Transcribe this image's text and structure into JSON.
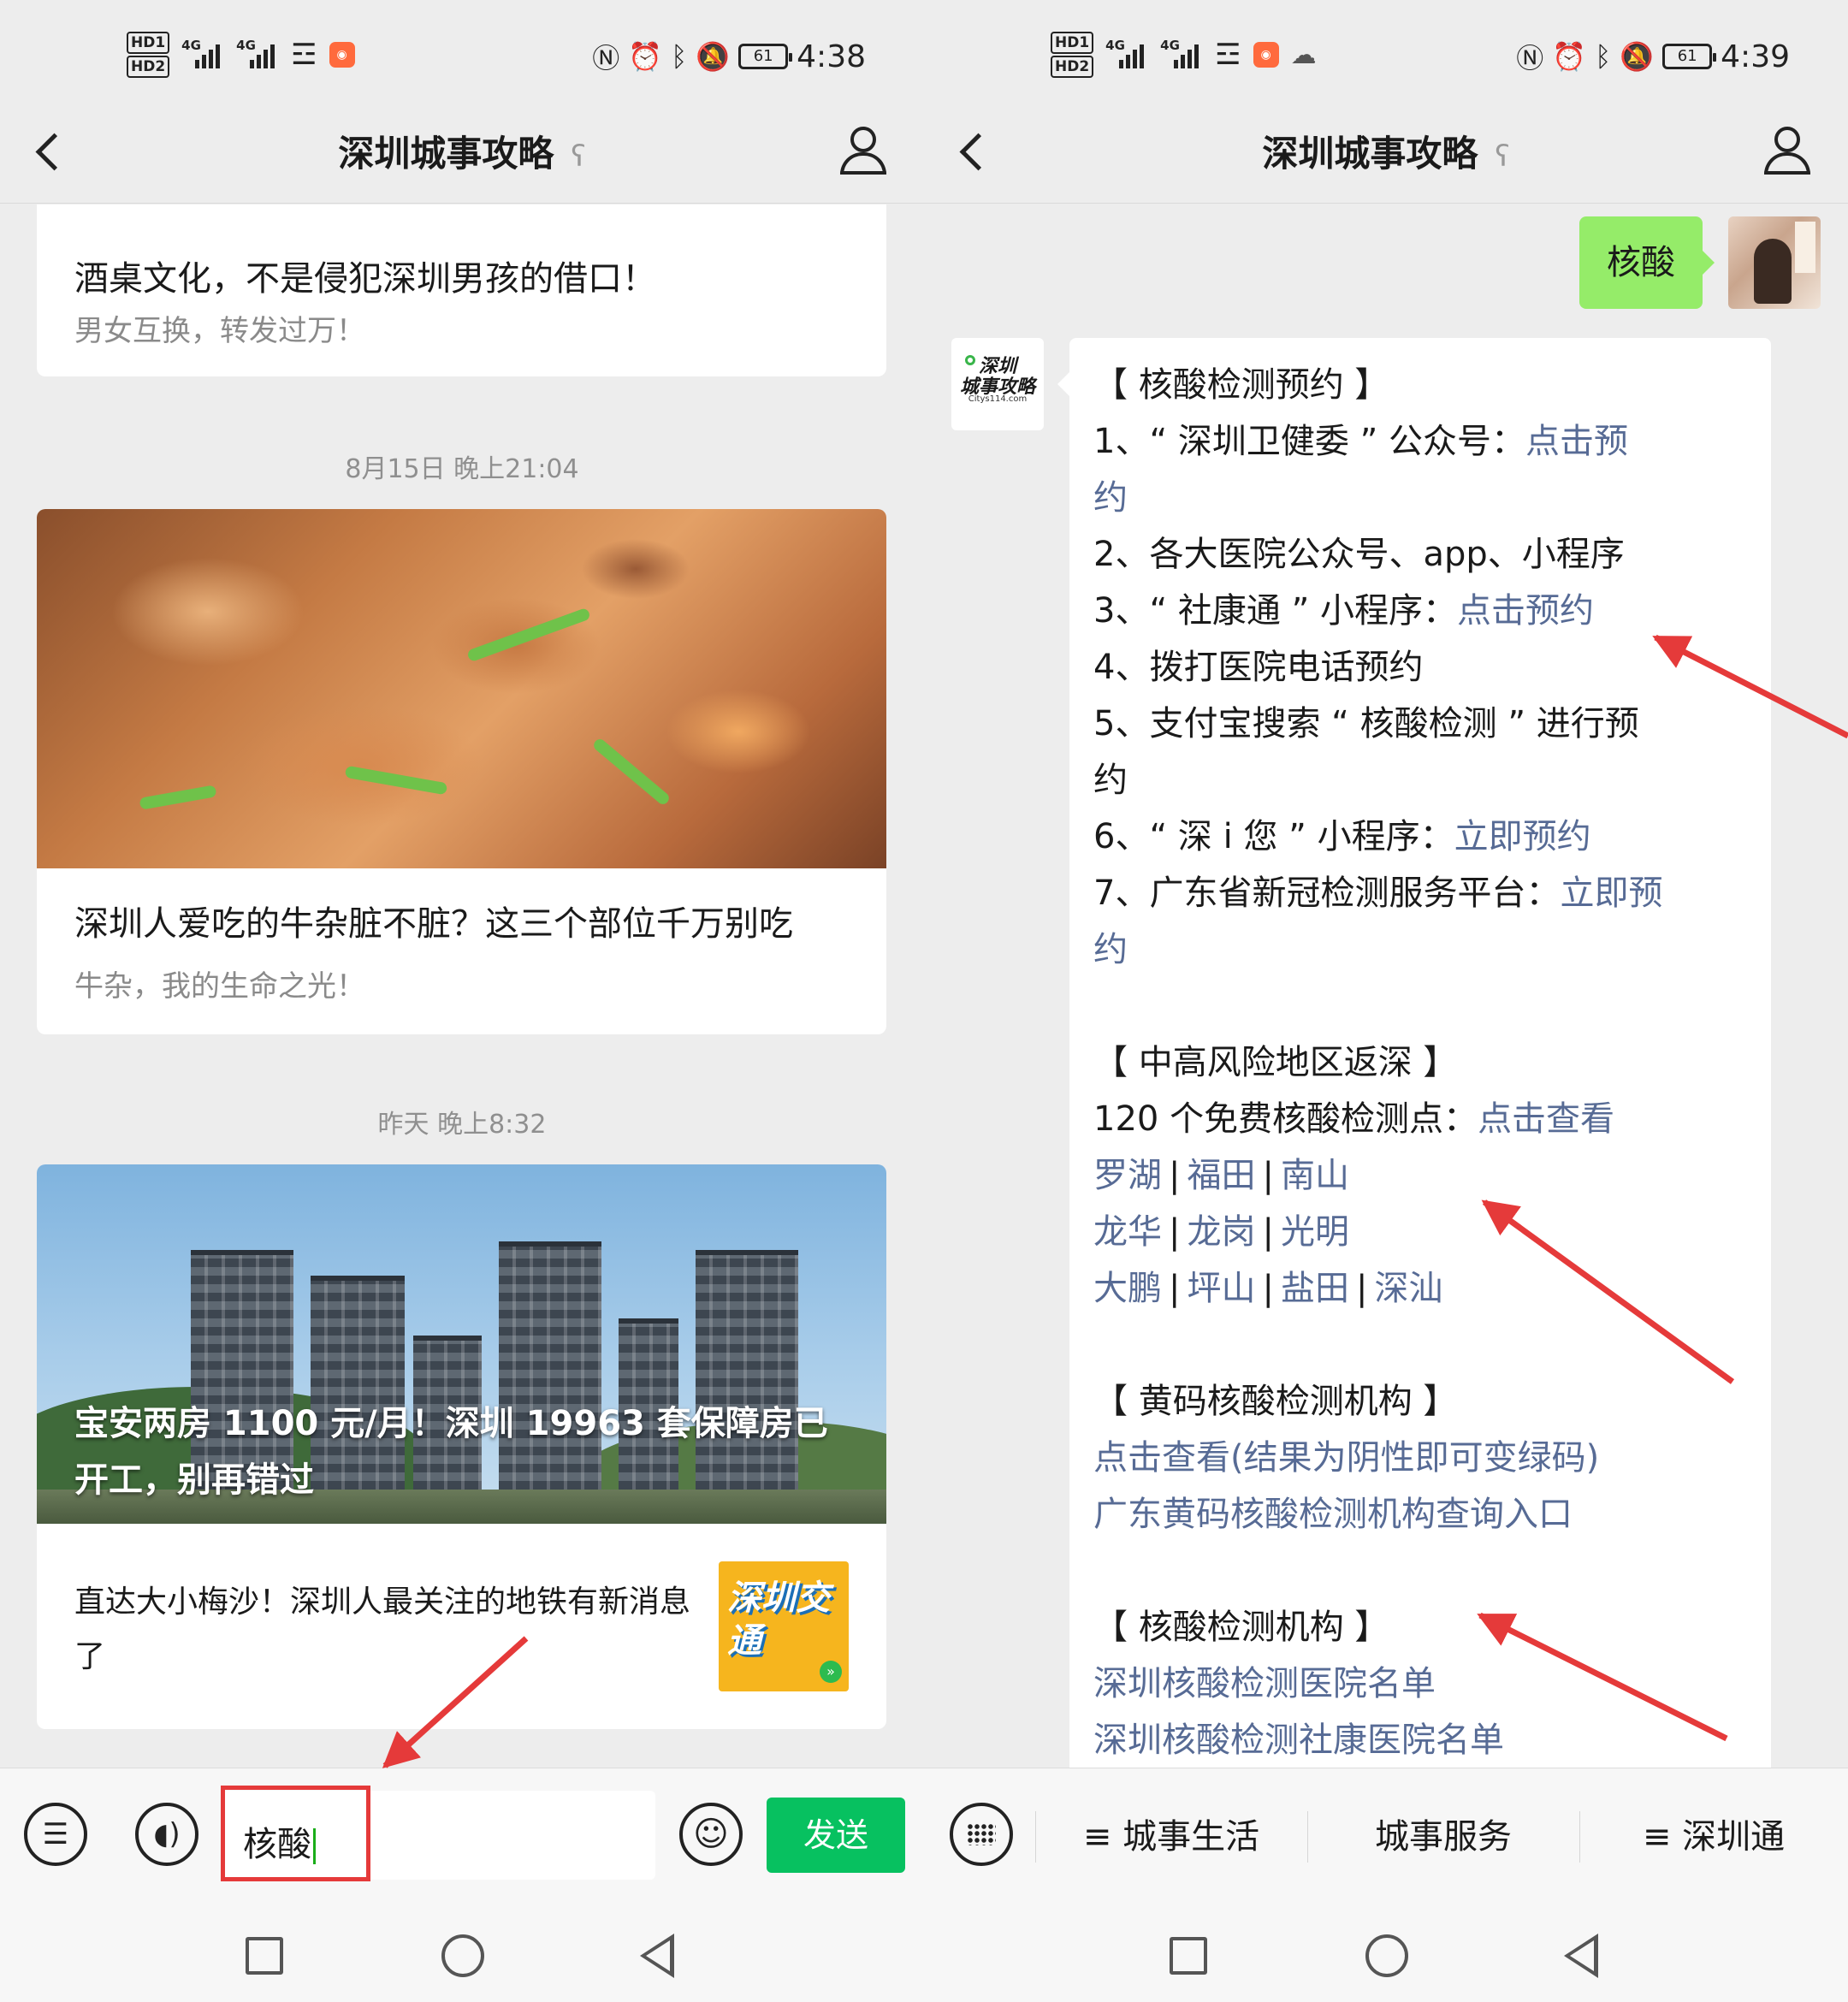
{
  "left": {
    "status": {
      "network_badges": [
        "HD1",
        "HD2"
      ],
      "signal1": "4G",
      "signal2": "4G",
      "battery": "61",
      "time": "4:38"
    },
    "header": {
      "title": "深圳城事攻略"
    },
    "articles": [
      {
        "title": "酒桌文化，不是侵犯深圳男孩的借口！",
        "subtitle": "男女互换，转发过万！"
      },
      {
        "timestamp": "8月15日 晚上21:04",
        "title": "深圳人爱吃的牛杂脏不脏？这三个部位千万别吃",
        "subtitle": "牛杂，我的生命之光！"
      },
      {
        "timestamp": "昨天 晚上8:32",
        "cover_title": "宝安两房 1100 元/月！深圳 19963 套保障房已开工，别再错过",
        "item_title": "直达大小梅沙！深圳人最关注的地铁有新消息了",
        "thumb_text": "深圳交通"
      }
    ],
    "input": {
      "value": "核酸",
      "send_label": "发送"
    }
  },
  "right": {
    "status": {
      "network_badges": [
        "HD1",
        "HD2"
      ],
      "signal1": "4G",
      "signal2": "4G",
      "battery": "61",
      "time": "4:39"
    },
    "header": {
      "title": "深圳城事攻略"
    },
    "my_message": "核酸",
    "bot_avatar": {
      "line1": "深圳",
      "line2": "城事攻略",
      "url": "Citys114.com"
    },
    "bot_message": {
      "s1_title": "【 核酸检测预约 】",
      "s1_l1_pre": "1、“ 深圳卫健委 ” 公众号：",
      "s1_l1_link_a": "点击预",
      "s1_l1_link_b": "约",
      "s1_l2": "2、各大医院公众号、app、小程序",
      "s1_l3_pre": "3、“ 社康通 ” 小程序：",
      "s1_l3_link": "点击预约",
      "s1_l4": "4、拨打医院电话预约",
      "s1_l5_a": "5、支付宝搜索 “ 核酸检测 ” 进行预",
      "s1_l5_b": "约",
      "s1_l6_pre": "6、“ 深 i 您 ” 小程序：",
      "s1_l6_link": "立即预约",
      "s1_l7_pre": "7、广东省新冠检测服务平台：",
      "s1_l7_link_a": "立即预",
      "s1_l7_link_b": "约",
      "s2_title": "【 中高风险地区返深 】",
      "s2_l1_pre": "120 个免费核酸检测点：",
      "s2_l1_link": "点击查看",
      "districts_row1": [
        "罗湖",
        "福田",
        "南山"
      ],
      "districts_row2": [
        "龙华",
        "龙岗",
        "光明"
      ],
      "districts_row3": [
        "大鹏",
        "坪山",
        "盐田",
        "深汕"
      ],
      "s3_title": "【 黄码核酸检测机构 】",
      "s3_link1": "点击查看(结果为阴性即可变绿码)",
      "s3_link2": "广东黄码核酸检测机构查询入口",
      "s4_title": "【 核酸检测机构 】",
      "s4_link1": "深圳核酸检测医院名单",
      "s4_link2": "深圳核酸检测社康医院名单"
    },
    "menu": [
      "≡ 城事生活",
      "城事服务",
      "≡ 深圳通"
    ]
  },
  "colors": {
    "link": "#576b95",
    "send_green": "#07c160",
    "my_bubble": "#95ec69",
    "annotation_red": "#e53a3a"
  }
}
